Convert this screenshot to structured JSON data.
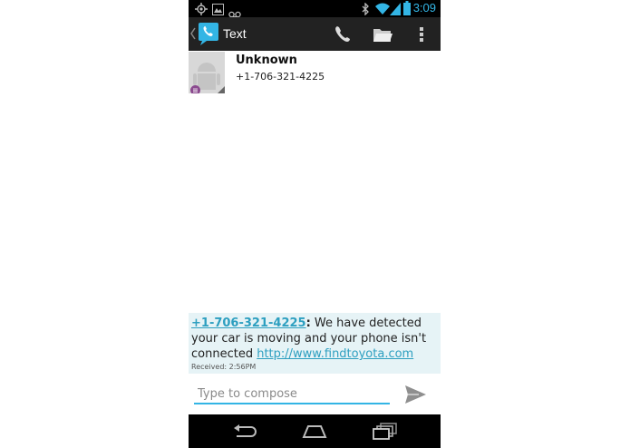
{
  "status_bar": {
    "time": "3:09",
    "left_icons": [
      "gps-icon",
      "gallery-notification-icon",
      "voicemail-icon"
    ],
    "right_icons": [
      "bluetooth-icon",
      "wifi-icon",
      "signal-icon",
      "battery-icon"
    ]
  },
  "action_bar": {
    "title": "Text",
    "icons": [
      "up-caret-icon",
      "app-phone-icon",
      "phone-icon",
      "folder-icon",
      "overflow-menu-icon"
    ]
  },
  "contact": {
    "name": "Unknown",
    "number": "+1-706-321-4225"
  },
  "message": {
    "sender": "+1-706-321-4225",
    "separator": ":",
    "body": " We have detected your car is moving and your phone isn't connected ",
    "link": "http://www.findtoyota.com",
    "received": "Received: 2:56PM"
  },
  "compose": {
    "placeholder": "Type to compose",
    "value": ""
  },
  "nav_bar": {
    "icons": [
      "back-icon",
      "home-icon",
      "recent-apps-icon"
    ]
  },
  "colors": {
    "accent": "#33b5e5",
    "link": "#2d9fc0",
    "message_bg": "#e6f3f6",
    "action_bar_bg": "#222222"
  }
}
